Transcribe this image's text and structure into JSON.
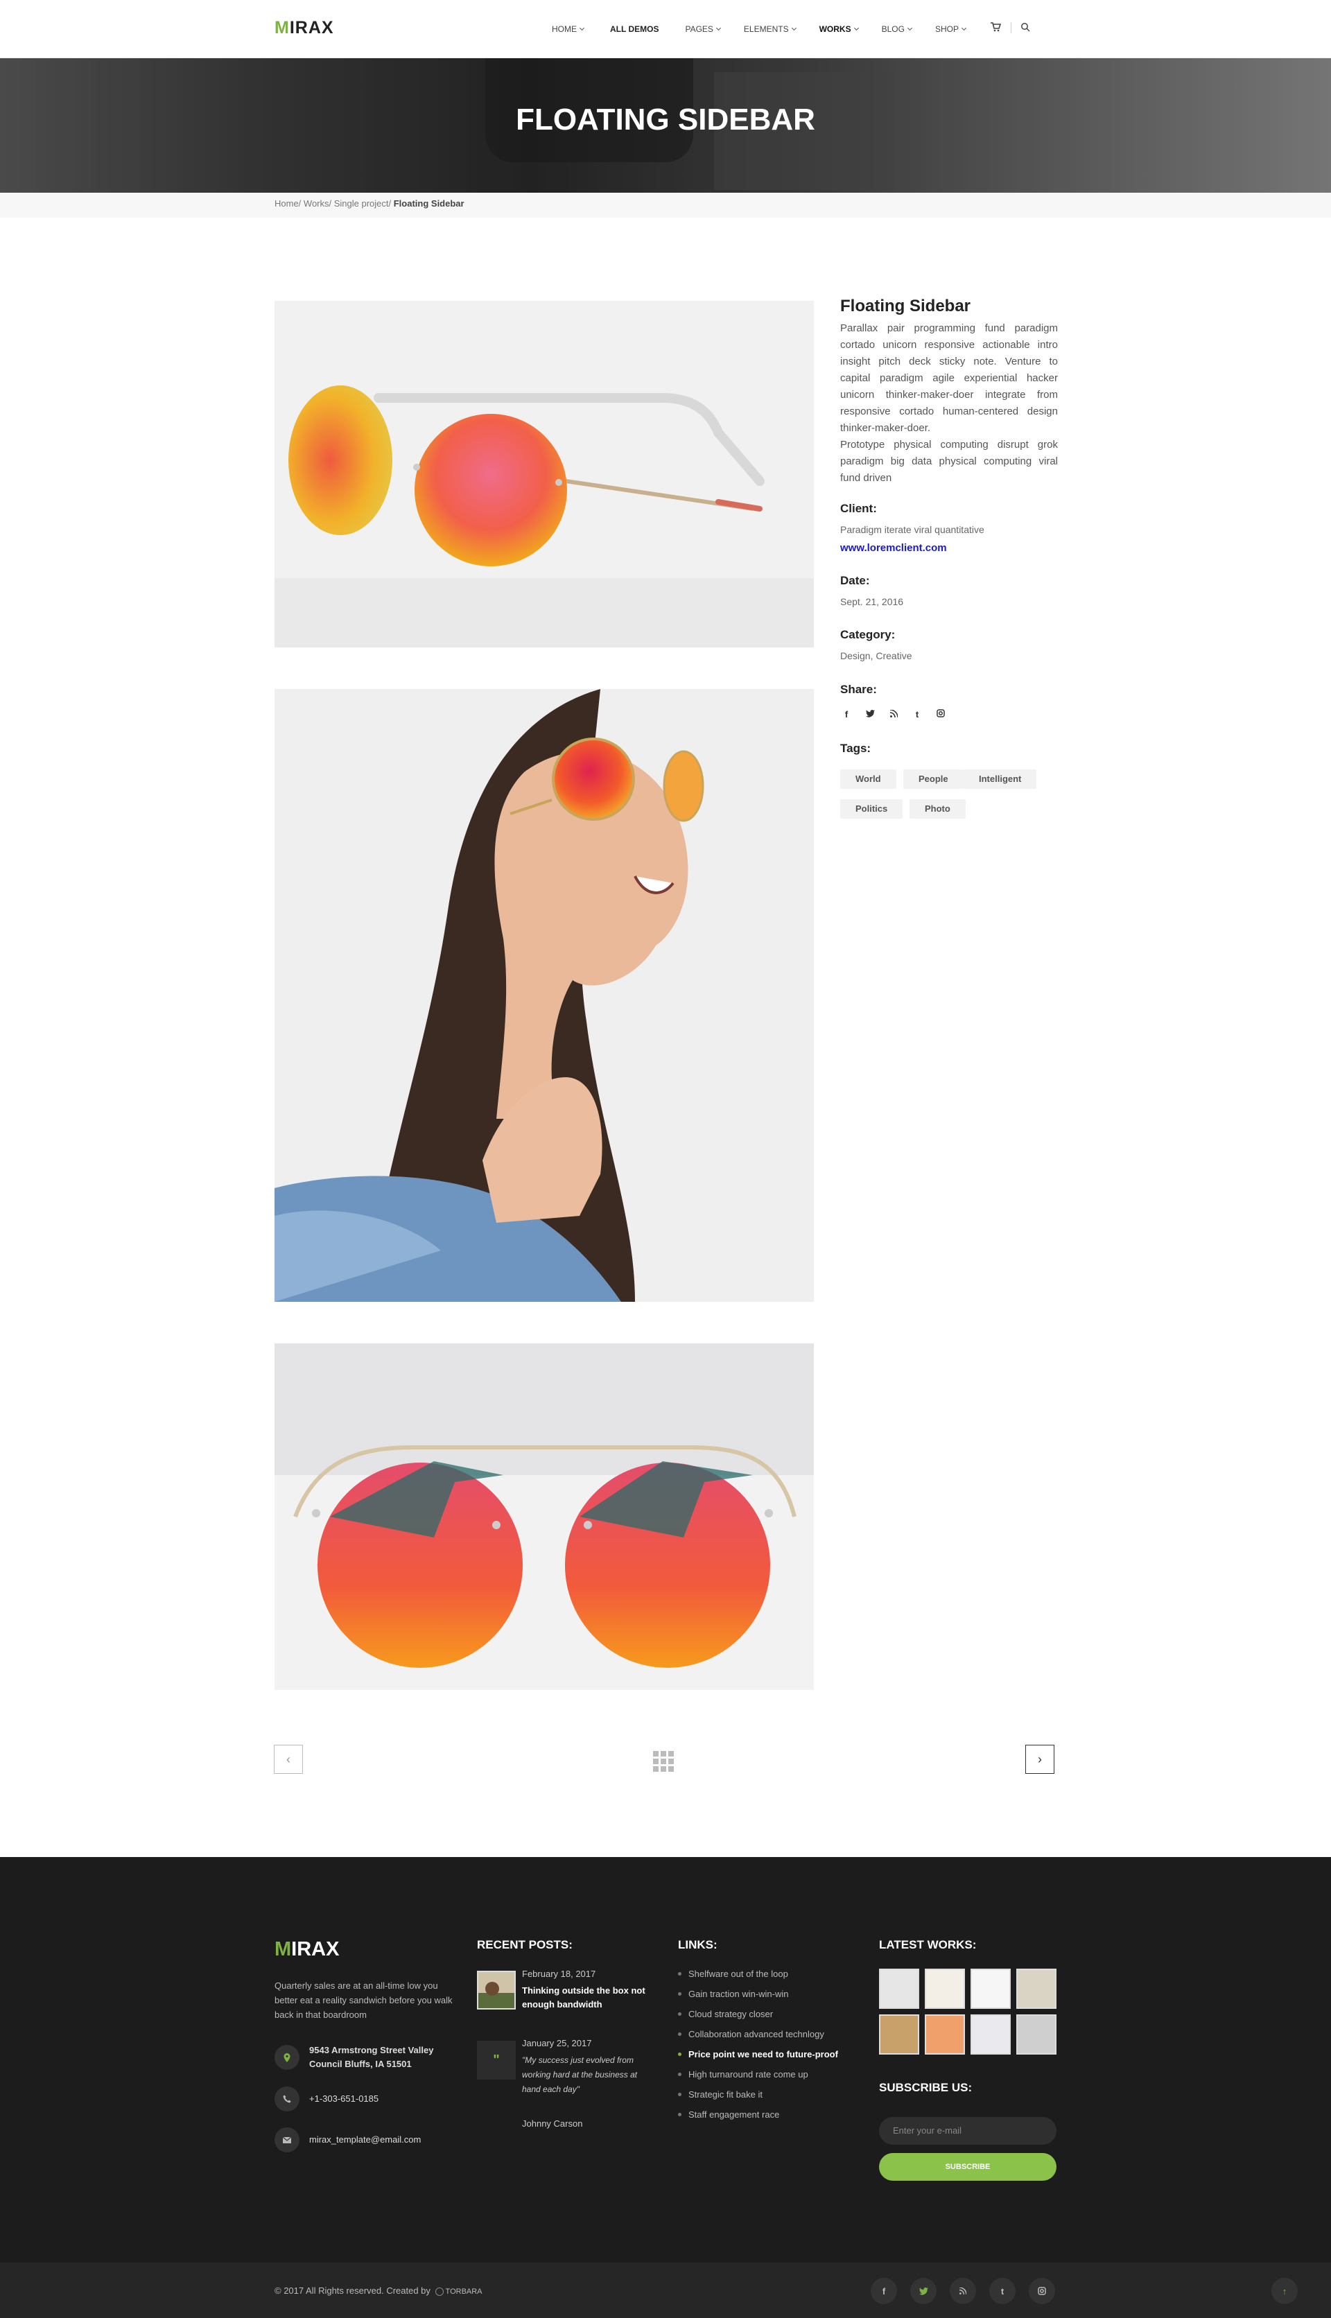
{
  "header": {
    "logo_m": "M",
    "logo_rest": "IRAX",
    "nav": [
      "HOME",
      "ALL DEMOS",
      "PAGES",
      "ELEMENTS",
      "WORKS",
      "BLOG",
      "SHOP"
    ],
    "cart_icon": "cart-icon",
    "search_icon": "search-icon"
  },
  "hero": {
    "title": "FLOATING SIDEBAR"
  },
  "breadcrumb": {
    "home": "Home/",
    "works": " Works/",
    "single": " Single project/",
    "current": " Floating Sidebar"
  },
  "sidebar": {
    "title": "Floating Sidebar",
    "description1": "Parallax pair programming fund paradigm cortado unicorn responsive actionable intro insight pitch deck sticky note. Venture to capital paradigm agile experiential hacker unicorn thinker-maker-doer integrate from responsive cortado human-centered design thinker-maker-doer.",
    "description2": "Prototype physical computing disrupt grok paradigm big data physical computing viral fund driven",
    "client_label": "Client:",
    "client_value": "Paradigm iterate viral quantitative",
    "client_link": "www.loremclient.com",
    "date_label": "Date:",
    "date_value": "Sept. 21, 2016",
    "category_label": "Category:",
    "category_value": "Design, Creative",
    "share_label": "Share:",
    "share_icons": [
      "facebook-icon",
      "twitter-icon",
      "rss-icon",
      "tumblr-icon",
      "instagram-icon"
    ],
    "tags_label": "Tags:",
    "tags": [
      "World",
      "People",
      "Intelligent",
      "Politics",
      "Photo"
    ]
  },
  "pager": {
    "prev": "‹",
    "next": "›"
  },
  "footer": {
    "logo_m": "M",
    "logo_rest": "IRAX",
    "about": "Quarterly sales are at an all-time low you better eat a reality sandwich before you walk back in that boardroom",
    "address1": "9543 Armstrong Street Valley",
    "address2": "Council Bluffs, IA 51501",
    "phone": "+1-303-651-0185",
    "email": "mirax_template@email.com",
    "recent_heading": "RECENT POSTS:",
    "post1_date": "February 18, 2017",
    "post1_title": "Thinking outside the box not enough bandwidth",
    "post2_date": "January 25, 2017",
    "post2_quote": "\"My success just evolved from working hard at the business at hand each day\"",
    "post2_author": "Johnny Carson",
    "links_heading": "LINKS:",
    "links": [
      "Shelfware out of the loop",
      "Gain traction win-win-win",
      "Cloud strategy closer",
      "Collaboration advanced technlogy",
      "Price point we need to future-proof",
      "High turnaround rate come up",
      "Strategic fit bake it",
      "Staff engagement race"
    ],
    "works_heading": "LATEST WORKS:",
    "subscribe_heading": "SUBSCRIBE US:",
    "subscribe_placeholder": "Enter your e-mail",
    "subscribe_button": "SUBSCRIBE",
    "copyright": "© 2017 All Rights reserved. Created by",
    "creator": "TORBARA"
  },
  "colors": {
    "accent": "#7cb342",
    "footer_bg": "#1c1c1c",
    "link": "#1a1acc"
  }
}
